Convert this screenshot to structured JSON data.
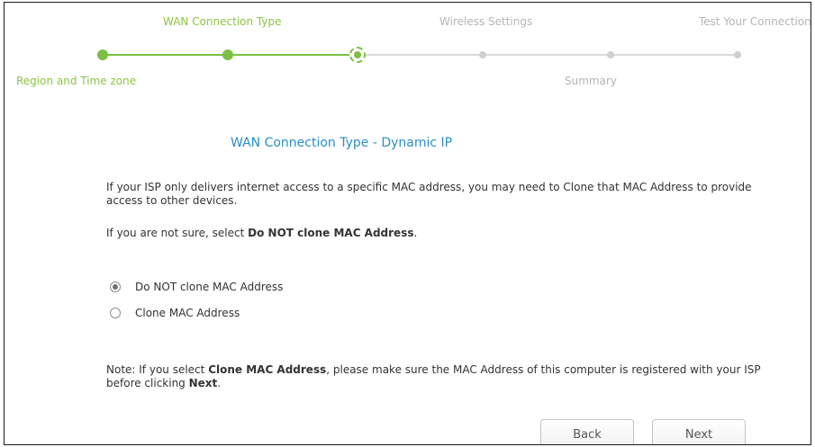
{
  "wizard": {
    "steps": {
      "region": "Region and Time zone",
      "wan": "WAN Connection Type",
      "wireless": "Wireless Settings",
      "summary": "Summary",
      "test": "Test Your Connection"
    },
    "current_step": 3,
    "total_steps": 6,
    "colors": {
      "done": "#7ac143",
      "todo": "#cfcfcf",
      "title": "#2a8fc2"
    }
  },
  "content": {
    "title": "WAN Connection Type - Dynamic IP",
    "intro": "If your ISP only delivers internet access to a specific MAC address, you may need to Clone that MAC Address to provide access to other devices.",
    "hint_prefix": "If you are not sure, select ",
    "hint_bold": "Do NOT clone MAC Address",
    "hint_suffix": ".",
    "options": [
      {
        "label": "Do NOT clone MAC Address",
        "selected": true
      },
      {
        "label": "Clone MAC Address",
        "selected": false
      }
    ],
    "note_prefix": "Note: If you select ",
    "note_bold_1": "Clone MAC Address",
    "note_middle": ", please make sure the MAC Address of this computer is registered with your ISP before clicking ",
    "note_bold_2": "Next",
    "note_suffix": "."
  },
  "buttons": {
    "back": "Back",
    "next": "Next"
  }
}
